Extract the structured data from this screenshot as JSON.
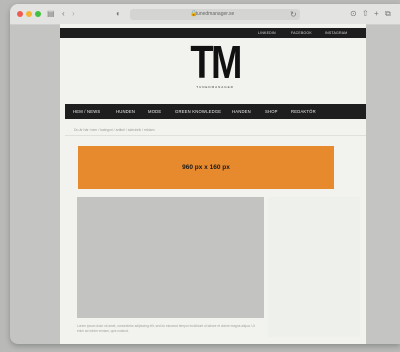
{
  "browser": {
    "url": "tunedmanager.se",
    "icons": {
      "sidebar": "sidebar-icon",
      "back": "back-chevron-icon",
      "shield": "shield-icon",
      "lock": "lock-icon",
      "reload": "reload-icon",
      "share": "share-icon",
      "download": "download-icon",
      "new_tab": "plus-icon",
      "tabs": "tabs-overview-icon"
    },
    "colors": {
      "close": "#ee5b53",
      "minimize": "#f2b632",
      "zoom": "#42c03f"
    }
  },
  "site": {
    "top_links": [
      "LINKEDIN",
      "FACEBOOK",
      "INSTAGRAM"
    ],
    "logo": "TM",
    "logo_tagline": "TUNEDMANAGER",
    "nav": [
      "HEM / NEWS",
      "HUNDEN",
      "MODE",
      "GREEN KNOWLEDGE",
      "HANDEN",
      "SHOP",
      "REDAKTÖR"
    ],
    "breadcrumb": "Du är här: hem / kategori / artikel / sidrubrik / reklam",
    "ad_banner_label": "960 px x 160 px",
    "excerpt": "Lorem ipsum dolor sit amet, consectetur adipiscing elit, sed do eiusmod tempor incididunt ut labore et dolore magna aliqua. Ut enim ad minim veniam, quis nostrud.",
    "colors": {
      "ad": "#e78a2e",
      "bars": "#1e1e1e"
    }
  }
}
